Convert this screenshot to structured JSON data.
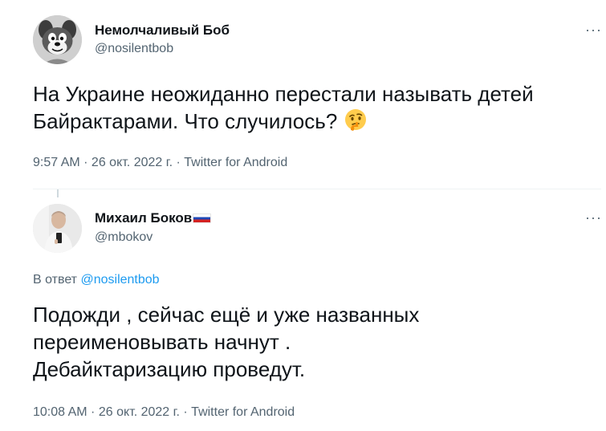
{
  "tweet1": {
    "author_name": "Немолчаливый Боб",
    "author_handle": "@nosilentbob",
    "more_label": "···",
    "text_line1": "На Украине неожиданно перестали называть детей",
    "text_line2": "Байрактарами. Что случилось?",
    "emoji": "thinking-face-icon",
    "timestamp": "9:57 AM · 26 окт. 2022 г. · Twitter for Android"
  },
  "tweet2": {
    "author_name": "Михаил Боков",
    "author_flag": "russia-flag-icon",
    "author_handle": "@mbokov",
    "more_label": "···",
    "reply_prefix": "В ответ",
    "reply_handle": "@nosilentbob",
    "text_line1": "Подожди , сейчас ещё и уже названных",
    "text_line2": "переименовывать начнут .",
    "text_line3": "Дебайктаризацию проведут.",
    "timestamp": "10:08 AM · 26 окт. 2022 г. · Twitter for Android"
  },
  "colors": {
    "text": "#0f1419",
    "secondary": "#536471",
    "link": "#1d9bf0",
    "divider": "#eff3f4"
  }
}
